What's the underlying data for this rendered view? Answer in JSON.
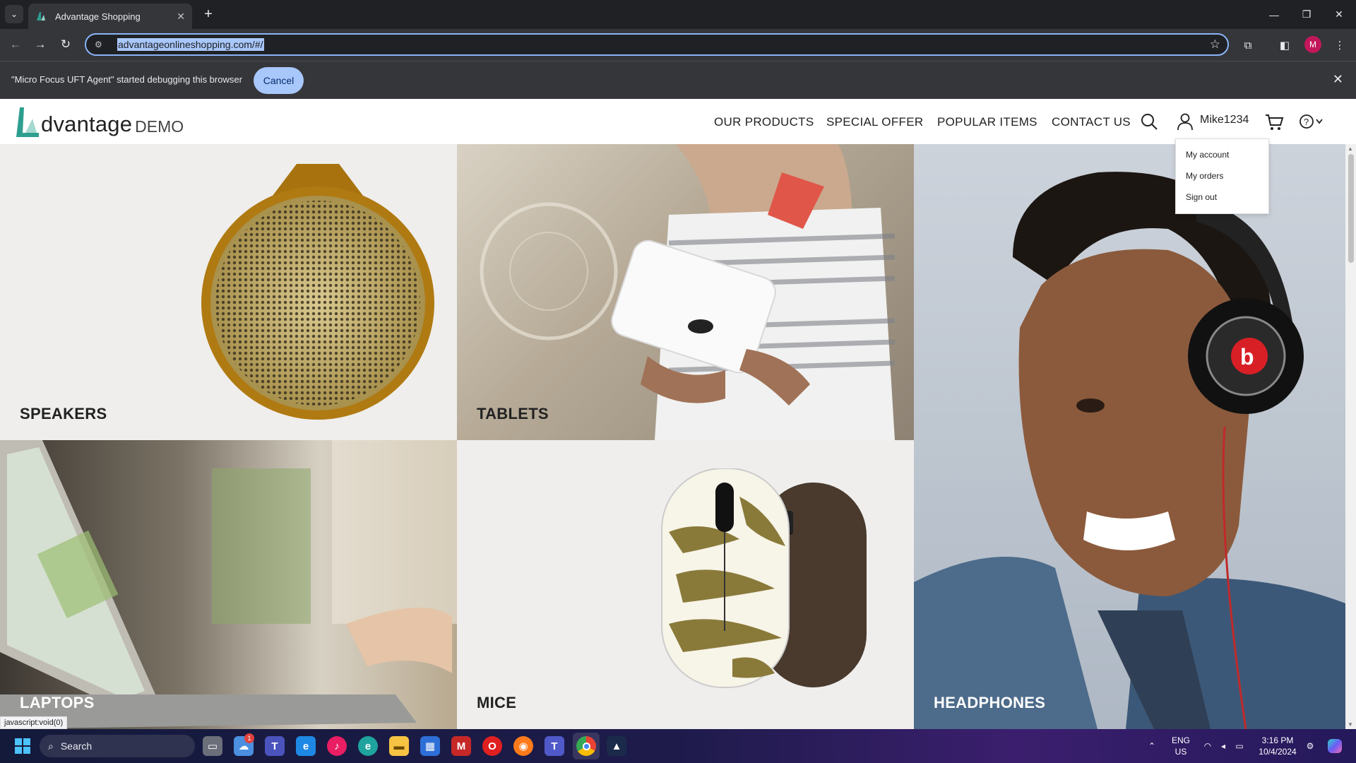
{
  "browser": {
    "tab_title": "Advantage Shopping",
    "tab_close": "✕",
    "new_tab": "+",
    "url": "advantageonlineshopping.com/#/",
    "profile_initial": "M",
    "window_controls": [
      "—",
      "❐",
      "✕"
    ]
  },
  "infobar": {
    "message": "\"Micro Focus UFT Agent\" started debugging this browser",
    "cancel_label": "Cancel",
    "close": "✕"
  },
  "site": {
    "logo_brand": "dvantage",
    "logo_demo": "DEMO",
    "accent_color": "#2e9e8f",
    "nav": [
      "OUR PRODUCTS",
      "SPECIAL OFFER",
      "POPULAR ITEMS",
      "CONTACT US"
    ],
    "username": "Mike1234",
    "user_menu": [
      "My account",
      "My orders",
      "Sign out"
    ]
  },
  "categories": [
    {
      "label": "SPEAKERS"
    },
    {
      "label": "TABLETS"
    },
    {
      "label": "HEADPHONES"
    },
    {
      "label": "LAPTOPS"
    },
    {
      "label": "MICE"
    }
  ],
  "status_url": "javascript:void(0)",
  "taskbar": {
    "search_placeholder": "Search",
    "language": "ENG",
    "region": "US",
    "time": "3:16 PM",
    "date": "10/4/2024",
    "notification_badge": "1"
  }
}
